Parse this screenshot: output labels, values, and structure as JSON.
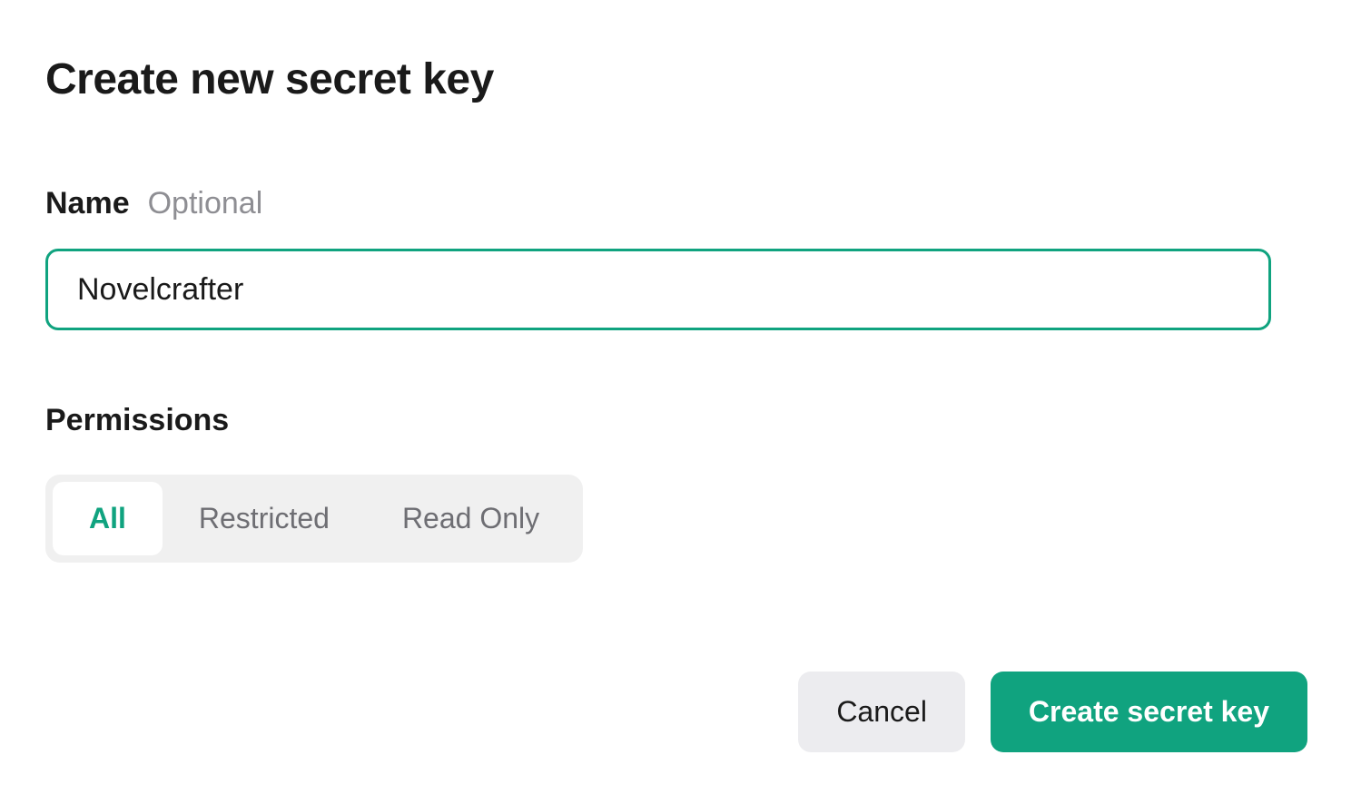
{
  "dialog": {
    "title": "Create new secret key"
  },
  "name_field": {
    "label": "Name",
    "optional_hint": "Optional",
    "value": "Novelcrafter"
  },
  "permissions": {
    "label": "Permissions",
    "options": [
      {
        "label": "All",
        "active": true
      },
      {
        "label": "Restricted",
        "active": false
      },
      {
        "label": "Read Only",
        "active": false
      }
    ]
  },
  "actions": {
    "cancel_label": "Cancel",
    "submit_label": "Create secret key"
  }
}
